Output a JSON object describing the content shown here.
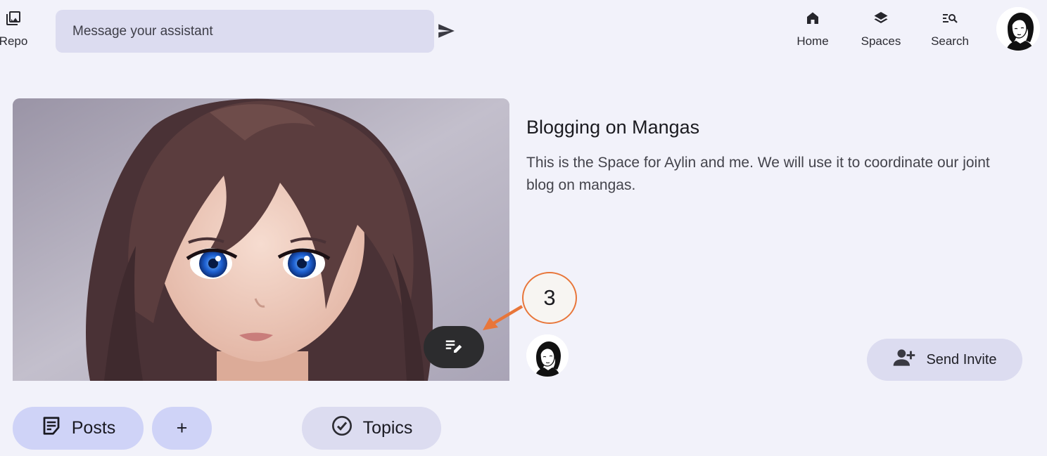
{
  "top_bar": {
    "repo_label": "Repo",
    "message_placeholder": "Message your assistant",
    "nav": {
      "home": "Home",
      "spaces": "Spaces",
      "search": "Search"
    }
  },
  "space": {
    "title": "Blogging on Mangas",
    "description": "This is the Space for Aylin and me. We will use it to coordinate our joint blog on mangas."
  },
  "annotation": {
    "step": "3",
    "color": "#e8763a"
  },
  "actions": {
    "send_invite": "Send Invite"
  },
  "tabs": {
    "posts": "Posts",
    "add": "+",
    "topics": "Topics"
  },
  "colors": {
    "background": "#f2f2fa",
    "input_bg": "#dcdcf0",
    "primary_pill": "#cfd3f7",
    "fab": "#2c2c2e"
  },
  "icons": {
    "repo": "photo-library-icon",
    "send": "send-icon",
    "home": "home-icon",
    "spaces": "layers-icon",
    "search": "manage-search-icon",
    "edit": "edit-note-icon",
    "invite": "person-add-icon",
    "posts": "sticky-note-icon",
    "topics": "check-circle-icon"
  }
}
